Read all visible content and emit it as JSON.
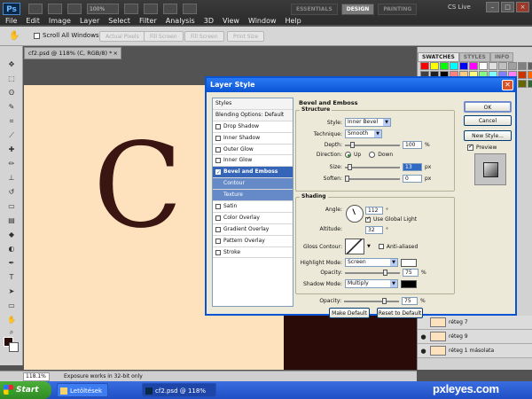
{
  "app": {
    "logo": "Ps",
    "zoom": "100%"
  },
  "menus": [
    "File",
    "Edit",
    "Image",
    "Layer",
    "Select",
    "Filter",
    "Analysis",
    "3D",
    "View",
    "Window",
    "Help"
  ],
  "workspaces": [
    {
      "label": "ESSENTIALS",
      "active": false
    },
    {
      "label": "DESIGN",
      "active": true
    },
    {
      "label": "PAINTING",
      "active": false
    }
  ],
  "cs_live": "CS Live",
  "options": {
    "scroll_all": "Scroll All Windows",
    "buttons": [
      "Actual Pixels",
      "Fill Screen",
      "Fill Screen",
      "Print Size"
    ]
  },
  "doc_tab": {
    "label": "cf2.psd @ 118% (C, RGB/8) *",
    "close": "×"
  },
  "canvas": {
    "letter": "C"
  },
  "panels": {
    "tabs": [
      "SWATCHES",
      "STYLES",
      "INFO"
    ],
    "swatch_colors": [
      "#ff0000",
      "#ffff00",
      "#00ff00",
      "#00ffff",
      "#0000ff",
      "#ff00ff",
      "#ffffff",
      "#e0e0e0",
      "#c0c0c0",
      "#a0a0a0",
      "#808080",
      "#606060",
      "#404040",
      "#202020",
      "#000000",
      "#ff8080",
      "#ffcc80",
      "#ffff80",
      "#80ff80",
      "#80ffff",
      "#8080ff",
      "#ff80ff",
      "#cc3300",
      "#ff6600",
      "#ffcc00",
      "#99cc00",
      "#33cc66",
      "#00cc99",
      "#0099cc",
      "#3366cc",
      "#6633cc",
      "#cc33cc",
      "#993300",
      "#996633",
      "#666600",
      "#336633"
    ],
    "layers": [
      {
        "name": "réteg 7",
        "visible": false
      },
      {
        "name": "réteg 9",
        "visible": true
      },
      {
        "name": "réteg 1 másolata",
        "visible": true
      }
    ]
  },
  "status": {
    "zoom": "118.1%",
    "message": "Exposure works in 32-bit only"
  },
  "taskbar": {
    "start": "Start",
    "tasks": [
      {
        "label": "Letöltések",
        "active": false
      },
      {
        "label": "cf2.psd @ 118% (C, ...",
        "active": true
      }
    ],
    "brand": "pxleyes.com"
  },
  "dialog": {
    "title": "Layer Style",
    "close": "✕",
    "styles_header": "Styles",
    "blending": "Blending Options: Default",
    "style_items": [
      {
        "label": "Drop Shadow",
        "checked": false,
        "kind": "item"
      },
      {
        "label": "Inner Shadow",
        "checked": false,
        "kind": "item"
      },
      {
        "label": "Outer Glow",
        "checked": false,
        "kind": "item"
      },
      {
        "label": "Inner Glow",
        "checked": false,
        "kind": "item"
      },
      {
        "label": "Bevel and Emboss",
        "checked": true,
        "kind": "selected"
      },
      {
        "label": "Contour",
        "checked": false,
        "kind": "sub"
      },
      {
        "label": "Texture",
        "checked": false,
        "kind": "sub"
      },
      {
        "label": "Satin",
        "checked": false,
        "kind": "item"
      },
      {
        "label": "Color Overlay",
        "checked": false,
        "kind": "item"
      },
      {
        "label": "Gradient Overlay",
        "checked": false,
        "kind": "item"
      },
      {
        "label": "Pattern Overlay",
        "checked": false,
        "kind": "item"
      },
      {
        "label": "Stroke",
        "checked": false,
        "kind": "item"
      }
    ],
    "bevel": {
      "title": "Bevel and Emboss",
      "structure_title": "Structure",
      "style_label": "Style:",
      "style_value": "Inner Bevel",
      "technique_label": "Technique:",
      "technique_value": "Smooth",
      "depth_label": "Depth:",
      "depth_value": "100",
      "depth_unit": "%",
      "depth_level": 0.1,
      "direction_label": "Direction:",
      "direction_up": "Up",
      "direction_down": "Down",
      "size_label": "Size:",
      "size_value": "13",
      "size_unit": "px",
      "size_level": 0.05,
      "soften_label": "Soften:",
      "soften_value": "0",
      "soften_unit": "px",
      "soften_level": 0.0,
      "shading_title": "Shading",
      "angle_label": "Angle:",
      "angle_value": "112",
      "angle_unit": "°",
      "global_light": "Use Global Light",
      "altitude_label": "Altitude:",
      "altitude_value": "32",
      "altitude_unit": "°",
      "gloss_label": "Gloss Contour:",
      "anti_aliased": "Anti-aliased",
      "highlight_label": "Highlight Mode:",
      "highlight_value": "Screen",
      "highlight_color": "#ffffff",
      "hl_opacity_label": "Opacity:",
      "hl_opacity_value": "75",
      "hl_opacity_unit": "%",
      "hl_opacity_level": 0.75,
      "shadow_label": "Shadow Mode:",
      "shadow_value": "Multiply",
      "shadow_color": "#000000",
      "sh_opacity_label": "Opacity:",
      "sh_opacity_value": "75",
      "sh_opacity_unit": "%",
      "sh_opacity_level": 0.75,
      "make_default": "Make Default",
      "reset_default": "Reset to Default"
    },
    "buttons": {
      "ok": "OK",
      "cancel": "Cancel",
      "new_style": "New Style...",
      "preview": "Preview"
    }
  }
}
